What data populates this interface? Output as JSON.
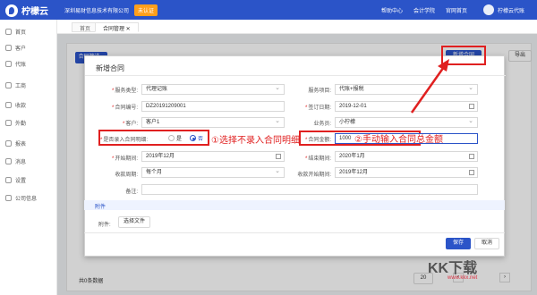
{
  "topbar": {
    "logo": "柠檬云",
    "company": "深圳易财信息技术有限公司",
    "badge": "未认证",
    "links": [
      "帮助中心",
      "会计学院",
      "官网首页"
    ],
    "user": "柠檬云代账"
  },
  "sidebar": {
    "items": [
      {
        "label": "首页",
        "icon": "home-icon"
      },
      {
        "label": "客户",
        "icon": "customer-icon"
      },
      {
        "label": "代账",
        "icon": "accounting-icon"
      },
      {
        "label": "工商",
        "icon": "business-icon"
      },
      {
        "label": "收款",
        "icon": "payment-icon"
      },
      {
        "label": "外勤",
        "icon": "field-icon"
      },
      {
        "label": "报表",
        "icon": "report-icon"
      },
      {
        "label": "消息",
        "icon": "message-icon"
      },
      {
        "label": "设置",
        "icon": "settings-icon"
      },
      {
        "label": "公司信息",
        "icon": "company-icon"
      }
    ]
  },
  "tabs": {
    "home": "首页",
    "contract": "合同管理 ✕"
  },
  "content": {
    "filter_label": "合同筛选 ▾",
    "new_contract": "新增合同",
    "export": "导出",
    "total": "共0条数据",
    "page_size": "20"
  },
  "modal": {
    "title": "新增合同",
    "fields": {
      "service_type": {
        "label": "服务类型:",
        "value": "代理记账"
      },
      "service_item": {
        "label": "服务项目:",
        "value": "代账+报税"
      },
      "contract_no": {
        "label": "合同编号:",
        "value": "DZ20191209001"
      },
      "sign_date": {
        "label": "签订日期:",
        "value": "2019-12-01"
      },
      "customer": {
        "label": "客户:",
        "value": "客户1"
      },
      "salesperson": {
        "label": "业务员:",
        "value": "小柠檬"
      },
      "record_detail": {
        "label": "是否录入合同明细:",
        "yes": "是",
        "no": "否"
      },
      "amount": {
        "label": "合同金额:",
        "value": "1000"
      },
      "start_period": {
        "label": "开始期间:",
        "value": "2019年12月"
      },
      "end_period": {
        "label": "结束期间:",
        "value": "2020年1月"
      },
      "pay_cycle": {
        "label": "收款周期:",
        "value": "每个月"
      },
      "pay_start": {
        "label": "收款开始期间:",
        "value": "2019年12月"
      },
      "remark": {
        "label": "备注:",
        "value": ""
      }
    },
    "attachment_section": "附件",
    "attachment_label": "附件:",
    "choose_file": "选择文件",
    "save": "保存",
    "cancel": "取消"
  },
  "annotations": {
    "one": "①选择不录入合同明细",
    "two": "②手动输入合同总金额"
  },
  "watermark": {
    "text": "KK下载",
    "url": "www.kkx.net"
  },
  "colors": {
    "brand": "#2b54c8",
    "annotation": "#e02020",
    "badge": "#ff9f1c"
  }
}
